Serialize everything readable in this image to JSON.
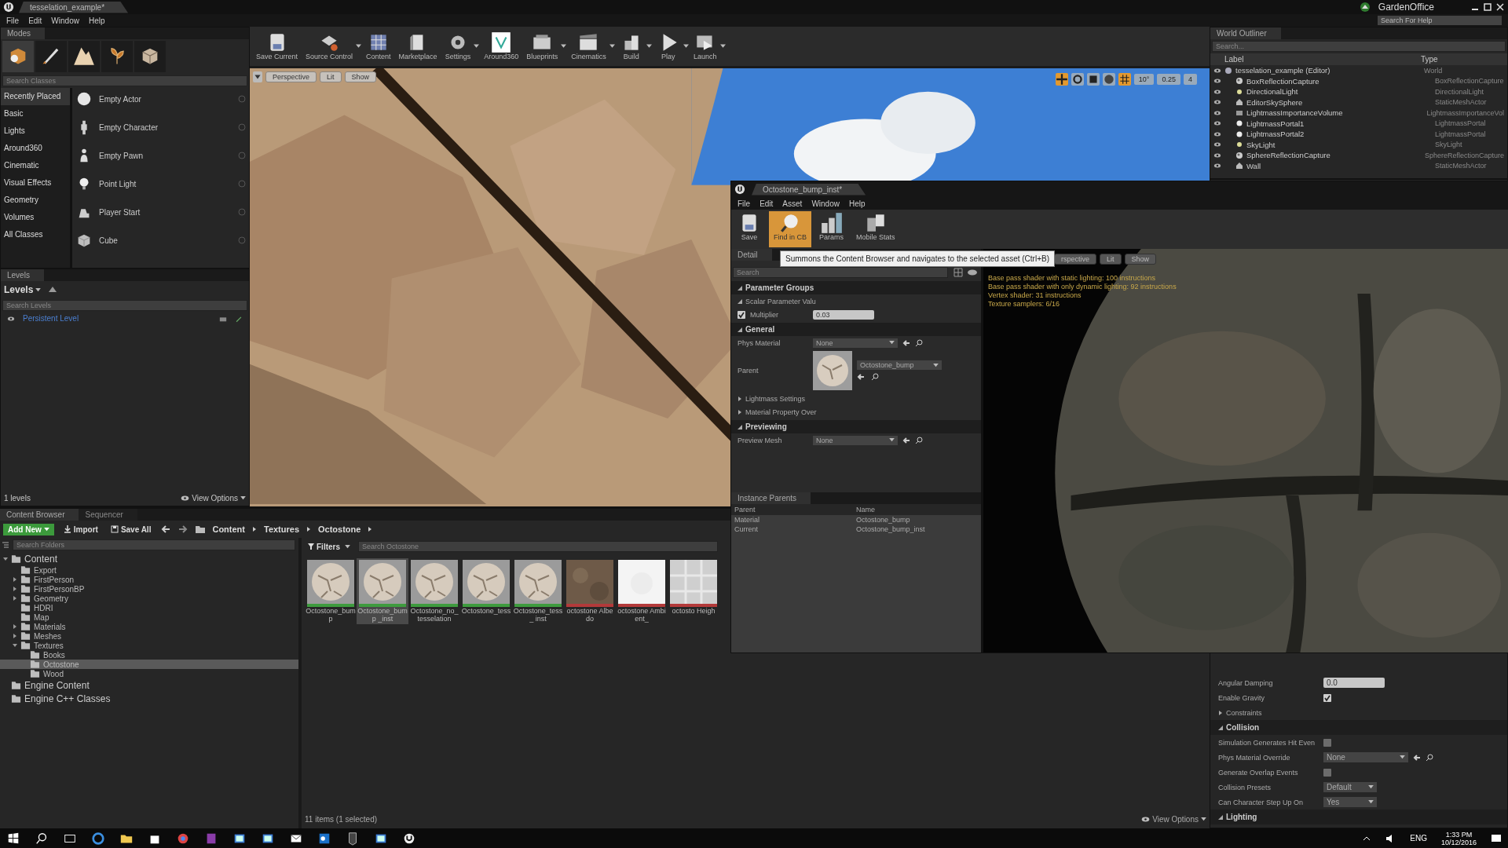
{
  "title_bar": {
    "document_tab": "tesselation_example*",
    "project": "GardenOffice",
    "help_search": {
      "placeholder": "Search For Help"
    }
  },
  "menu": [
    "File",
    "Edit",
    "Window",
    "Help"
  ],
  "modes": {
    "tab": "Modes",
    "tools": [
      {
        "kind": "place",
        "selected": true
      },
      {
        "kind": "paint",
        "selected": false
      },
      {
        "kind": "landscape",
        "selected": false
      },
      {
        "kind": "foliage",
        "selected": false
      },
      {
        "kind": "geometry",
        "selected": false
      }
    ],
    "search": {
      "placeholder": "Search Classes"
    },
    "categories": [
      {
        "label": "Recently Placed",
        "selected": true
      },
      {
        "label": "Basic",
        "selected": false
      },
      {
        "label": "Lights",
        "selected": false
      },
      {
        "label": "Around360",
        "selected": false
      },
      {
        "label": "Cinematic",
        "selected": false
      },
      {
        "label": "Visual Effects",
        "selected": false
      },
      {
        "label": "Geometry",
        "selected": false
      },
      {
        "label": "Volumes",
        "selected": false
      },
      {
        "label": "All Classes",
        "selected": false
      }
    ],
    "items": [
      {
        "label": "Empty Actor",
        "kind": "sphere"
      },
      {
        "label": "Empty Character",
        "kind": "character"
      },
      {
        "label": "Empty Pawn",
        "kind": "pawn"
      },
      {
        "label": "Point Light",
        "kind": "bulb"
      },
      {
        "label": "Player Start",
        "kind": "player"
      },
      {
        "label": "Cube",
        "kind": "cube"
      }
    ]
  },
  "levels": {
    "tab": "Levels",
    "dropdown": "Levels",
    "search": {
      "placeholder": "Search Levels"
    },
    "rows": [
      "Persistent Level"
    ],
    "count": "1 levels",
    "view_options": "View Options"
  },
  "toolbar": [
    {
      "label": "Save Current",
      "kind": "save",
      "menu": false
    },
    {
      "label": "Source Control",
      "kind": "source",
      "menu": true
    },
    {
      "label": "Content",
      "kind": "content",
      "menu": false
    },
    {
      "label": "Marketplace",
      "kind": "market",
      "menu": false
    },
    {
      "label": "Settings",
      "kind": "settings",
      "menu": true
    },
    {
      "label": "Around360",
      "kind": "around",
      "menu": false
    },
    {
      "label": "Blueprints",
      "kind": "blueprints",
      "menu": true
    },
    {
      "label": "Cinematics",
      "kind": "cinematics",
      "menu": true
    },
    {
      "label": "Build",
      "kind": "build",
      "menu": true
    },
    {
      "label": "Play",
      "kind": "play",
      "menu": true
    },
    {
      "label": "Launch",
      "kind": "launch",
      "menu": true
    }
  ],
  "viewport": {
    "view_mode": "Perspective",
    "lighting": "Lit",
    "show": "Show",
    "grid_angle": "10°",
    "snap_scale": "0.25",
    "camera_speed": "4"
  },
  "outliner": {
    "tab": "World Outliner",
    "search": {
      "placeholder": "Search..."
    },
    "columns": [
      "Label",
      "Type"
    ],
    "rows": [
      {
        "label": "tesselation_example (Editor)",
        "type": "World",
        "kind": "world",
        "children": [
          {
            "label": "BoxReflectionCapture",
            "type": "BoxReflectionCapture",
            "kind": "capture"
          },
          {
            "label": "DirectionalLight",
            "type": "DirectionalLight",
            "kind": "sun"
          },
          {
            "label": "EditorSkySphere",
            "type": "StaticMeshActor",
            "kind": "house"
          },
          {
            "label": "LightmassImportanceVolume",
            "type": "LightmassImportanceVol",
            "kind": "volume"
          },
          {
            "label": "LightmassPortal1",
            "type": "LightmassPortal",
            "kind": "dot"
          },
          {
            "label": "LightmassPortal2",
            "type": "LightmassPortal",
            "kind": "dot"
          },
          {
            "label": "SkyLight",
            "type": "SkyLight",
            "kind": "sun"
          },
          {
            "label": "SphereReflectionCapture",
            "type": "SphereReflectionCapture",
            "kind": "capture"
          },
          {
            "label": "Wall",
            "type": "StaticMeshActor",
            "kind": "house"
          }
        ]
      }
    ]
  },
  "material_editor": {
    "tab": "Octostone_bump_inst*",
    "menu": [
      "File",
      "Edit",
      "Asset",
      "Window",
      "Help"
    ],
    "toolbar": [
      {
        "label": "Save",
        "kind": "save",
        "selected": false
      },
      {
        "label": "Find in CB",
        "kind": "find",
        "selected": true
      },
      {
        "label": "Params",
        "kind": "params",
        "selected": false
      },
      {
        "label": "Mobile Stats",
        "kind": "mobile",
        "selected": false
      }
    ],
    "tooltip": "Summons the Content Browser and navigates to the selected asset (Ctrl+B)",
    "details": {
      "tab": "Detail",
      "search": {
        "placeholder": "Search"
      },
      "rows": [
        {
          "kind": "section",
          "label": "Parameter Groups"
        },
        {
          "kind": "group",
          "label": "Scalar Parameter Valu",
          "expanded": true
        },
        {
          "kind": "scalar",
          "label": "Multiplier",
          "checked": true,
          "value": "0.03"
        },
        {
          "kind": "section",
          "label": "General"
        },
        {
          "kind": "asset",
          "label": "Phys Material",
          "value": "None"
        },
        {
          "kind": "parent",
          "label": "Parent",
          "value": "Octostone_bump"
        },
        {
          "kind": "group",
          "label": "Lightmass Settings",
          "expanded": false
        },
        {
          "kind": "group",
          "label": "Material Property Over",
          "expanded": false
        },
        {
          "kind": "section",
          "label": "Previewing"
        },
        {
          "kind": "asset",
          "label": "Preview Mesh",
          "value": "None"
        }
      ]
    },
    "instance_parents": {
      "tab": "Instance Parents",
      "columns": [
        "Parent",
        "Name"
      ],
      "rows": [
        [
          "Material",
          "Octostone_bump"
        ],
        [
          "Current",
          "Octostone_bump_inst"
        ]
      ]
    },
    "preview": {
      "view_mode": "rspective",
      "lighting": "Lit",
      "show": "Show",
      "stats": [
        "Base pass shader with static lighting: 100 instructions",
        "Base pass shader with only dynamic lighting: 92 instructions",
        "Vertex shader: 31 instructions",
        "Texture samplers: 6/16"
      ]
    }
  },
  "content_browser": {
    "tabs": [
      {
        "label": "Content Browser",
        "selected": true
      },
      {
        "label": "Sequencer",
        "selected": false
      }
    ],
    "add_new": "Add New",
    "import": "Import",
    "save_all": "Save All",
    "path": [
      "Content",
      "Textures",
      "Octostone"
    ],
    "folder_search": {
      "placeholder": "Search Folders"
    },
    "filters": "Filters",
    "asset_search": {
      "placeholder": "Search Octostone"
    },
    "tree": [
      {
        "label": "Content",
        "expanded": true,
        "selected": false,
        "children": [
          {
            "label": "Export",
            "selected": false
          },
          {
            "label": "FirstPerson",
            "expanded": false,
            "selected": false
          },
          {
            "label": "FirstPersonBP",
            "expanded": false,
            "selected": false
          },
          {
            "label": "Geometry",
            "expanded": false,
            "selected": false
          },
          {
            "label": "HDRI",
            "selected": false
          },
          {
            "label": "Map",
            "selected": false
          },
          {
            "label": "Materials",
            "expanded": false,
            "selected": false
          },
          {
            "label": "Meshes",
            "expanded": false,
            "selected": false
          },
          {
            "label": "Textures",
            "expanded": true,
            "selected": false,
            "children": [
              {
                "label": "Books",
                "selected": false
              },
              {
                "label": "Octostone",
                "selected": true
              },
              {
                "label": "Wood",
                "selected": false
              }
            ]
          }
        ]
      },
      {
        "label": "Engine Content",
        "selected": false
      },
      {
        "label": "Engine C++ Classes",
        "selected": false
      }
    ],
    "assets": [
      {
        "label": "Octostone_bump",
        "kind": "material",
        "selected": false
      },
      {
        "label": "Octostone_bump _inst",
        "kind": "material",
        "selected": true
      },
      {
        "label": "Octostone_no_ tesselation",
        "kind": "material",
        "selected": false
      },
      {
        "label": "Octostone_tess",
        "kind": "material",
        "selected": false
      },
      {
        "label": "Octostone_tess_ inst",
        "kind": "material",
        "selected": false
      },
      {
        "label": "octostone Albedo",
        "kind": "albedo",
        "selected": false
      },
      {
        "label": "octostone Ambient_",
        "kind": "occlusion",
        "selected": false
      },
      {
        "label": "octosto Heigh",
        "kind": "height",
        "selected": false
      }
    ],
    "status": "11 items (1 selected)",
    "view_options": "View Options"
  },
  "details": {
    "rows": [
      {
        "kind": "number",
        "label": "Angular Damping",
        "value": "0.0"
      },
      {
        "kind": "checkbox",
        "label": "Enable Gravity",
        "checked": true
      },
      {
        "kind": "group",
        "label": "Constraints"
      },
      {
        "kind": "section",
        "label": "Collision"
      },
      {
        "kind": "checkbox",
        "label": "Simulation Generates Hit Even",
        "checked": false
      },
      {
        "kind": "asset",
        "label": "Phys Material Override",
        "value": "None"
      },
      {
        "kind": "checkbox",
        "label": "Generate Overlap Events",
        "checked": false
      },
      {
        "kind": "dropdown",
        "label": "Collision Presets",
        "value": "Default"
      },
      {
        "kind": "dropdown",
        "label": "Can Character Step Up On",
        "value": "Yes"
      },
      {
        "kind": "section",
        "label": "Lighting"
      }
    ]
  },
  "taskbar": {
    "apps": [
      {
        "kind": "start"
      },
      {
        "kind": "search"
      },
      {
        "kind": "taskview"
      },
      {
        "kind": "browser"
      },
      {
        "kind": "folder"
      },
      {
        "kind": "store"
      },
      {
        "kind": "chrome"
      },
      {
        "kind": "notes"
      },
      {
        "kind": "window"
      },
      {
        "kind": "window"
      },
      {
        "kind": "mail"
      },
      {
        "kind": "mailapp"
      },
      {
        "kind": "launcher"
      },
      {
        "kind": "window"
      },
      {
        "kind": "engine"
      }
    ],
    "language": "ENG",
    "time": "1:33 PM",
    "date": "10/12/2016"
  }
}
